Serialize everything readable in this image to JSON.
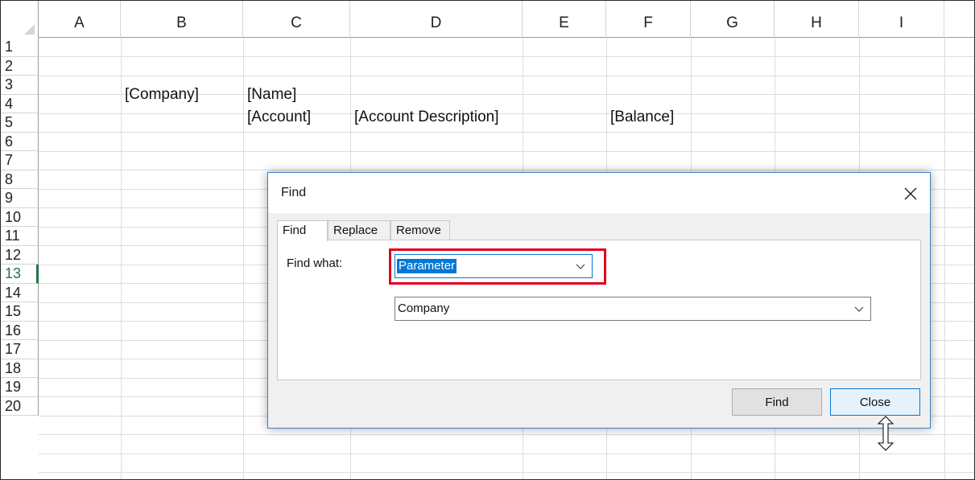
{
  "spreadsheet": {
    "columns": [
      "A",
      "B",
      "C",
      "D",
      "E",
      "F",
      "G",
      "H",
      "I"
    ],
    "rows": [
      "1",
      "2",
      "3",
      "4",
      "5",
      "6",
      "7",
      "8",
      "9",
      "10",
      "11",
      "12",
      "13",
      "14",
      "15",
      "16",
      "17",
      "18",
      "19",
      "20"
    ],
    "selected_row": "13",
    "cells": {
      "B3": "[Company]",
      "C3": "[Name]",
      "C4": "[Account]",
      "D4": "[Account Description]",
      "F4": "[Balance]"
    }
  },
  "dialog": {
    "title": "Find",
    "close_icon": "close-icon",
    "tabs": [
      "Find",
      "Replace",
      "Remove"
    ],
    "active_tab": "Find",
    "find_what_label": "Find what:",
    "find_what_dropdown_value": "Parameter",
    "parameter_dropdown_value": "Company",
    "find_button": "Find",
    "close_button": "Close"
  },
  "colors": {
    "accent": "#0078d7",
    "highlight": "#e2001a",
    "selected_row_header": "#217346"
  }
}
